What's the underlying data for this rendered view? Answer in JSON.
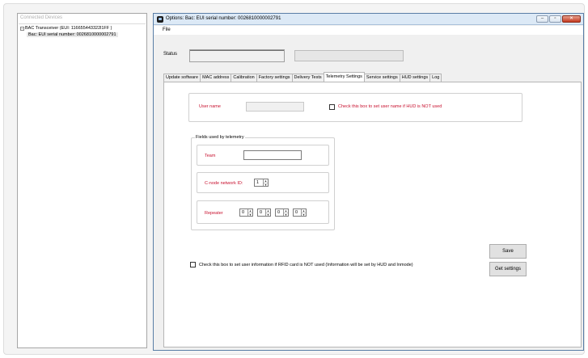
{
  "devices_panel": {
    "title": "Connected Devices",
    "root": "BAC Transceiver (EUI: 116655443322l1FF )",
    "child": "Bac: EUI serial number: 0026810000002791"
  },
  "window": {
    "title": "Options: Bac: EUI serial number: 0026810000002791",
    "controls": {
      "minimize": "–",
      "maximize": "▫",
      "close": "✕"
    },
    "menu": {
      "file": "File"
    },
    "status_label": "Status",
    "status_value": "",
    "status_detail": ""
  },
  "tabs": [
    {
      "label": "Update software",
      "active": false
    },
    {
      "label": "MAC address",
      "active": false
    },
    {
      "label": "Calibration",
      "active": false
    },
    {
      "label": "Factory settings",
      "active": false
    },
    {
      "label": "Delivery Tests",
      "active": false
    },
    {
      "label": "Telemetry Settings",
      "active": true
    },
    {
      "label": "Service settings",
      "active": false
    },
    {
      "label": "HUD settings",
      "active": false
    },
    {
      "label": "Log",
      "active": false
    }
  ],
  "telemetry": {
    "user_name_label": "User name",
    "user_name_value": "",
    "hud_checkbox_label": "Check this box to set user name if HUD is NOT used",
    "fields_legend": "Fields used by telemetry",
    "team_label": "Team",
    "team_value": "",
    "cnode_label": "C-node network ID:",
    "cnode_value": "1",
    "repeater_label": "Repeater",
    "repeater_values": [
      "0",
      "0",
      "0",
      "0"
    ],
    "rfid_checkbox_label": "Check this box to set user information if RFID card is NOT used (Information will be set by HUD and Inmode)",
    "save_label": "Save",
    "get_settings_label": "Get settings"
  },
  "colors": {
    "accent_red": "#c8102e",
    "window_border": "#5a7ea6",
    "titlebar": "#dce9f6"
  }
}
